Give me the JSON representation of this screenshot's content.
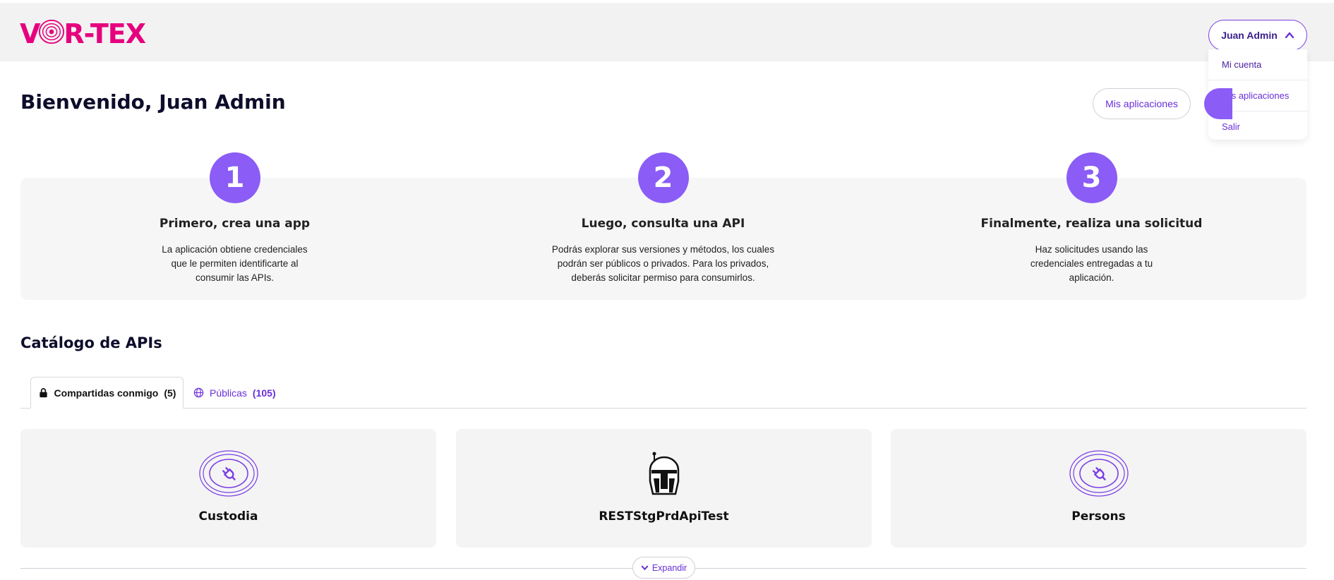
{
  "brand": {
    "logo_text_left": "V",
    "logo_text_right": "R-TEX",
    "logo_color": "#e6007e",
    "accent": "#8b5cf6"
  },
  "header": {
    "user_menu_label": "Juan Admin",
    "dropdown": [
      "Mi cuenta",
      "Mis aplicaciones",
      "Salir"
    ]
  },
  "welcome": {
    "title": "Bienvenido, Juan Admin",
    "my_apps_button": "Mis aplicaciones"
  },
  "steps": [
    {
      "num": "1",
      "title": "Primero, crea una app",
      "desc": [
        "La aplicación obtiene credenciales",
        "que le permiten identificarte al",
        "consumir las APIs."
      ]
    },
    {
      "num": "2",
      "title": "Luego, consulta una API",
      "desc": [
        "Podrás explorar sus versiones y métodos, los cuales",
        "podrán ser públicos o privados. Para los privados,",
        "deberás solicitar permiso para consumirlos."
      ]
    },
    {
      "num": "3",
      "title": "Finalmente, realiza una solicitud",
      "desc": [
        "Haz solicitudes usando las",
        "credenciales entregadas a tu",
        "aplicación."
      ]
    }
  ],
  "catalog": {
    "title": "Catálogo de APIs",
    "tabs": [
      {
        "label": "Compartidas conmigo",
        "count": "(5)",
        "icon": "lock-icon"
      },
      {
        "label": "Públicas",
        "count": "(105)",
        "icon": "globe-icon"
      }
    ],
    "cards": [
      {
        "name": "Custodia",
        "icon": "plug-icon"
      },
      {
        "name": "RESTStgPrdApiTest",
        "icon": "helmet-icon"
      },
      {
        "name": "Persons",
        "icon": "plug-icon"
      }
    ],
    "expand_label": "Expandir"
  }
}
